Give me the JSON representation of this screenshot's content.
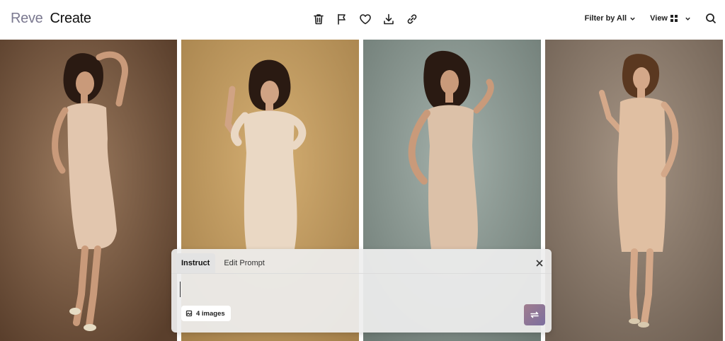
{
  "brand": {
    "name": "Reve",
    "section": "Create"
  },
  "toolbar": {
    "icons": [
      "trash-icon",
      "flag-icon",
      "heart-icon",
      "download-icon",
      "link-icon"
    ]
  },
  "controls": {
    "filter_label": "Filter by All",
    "view_label": "View"
  },
  "gallery": {
    "images": [
      {
        "background": "#7d5e45"
      },
      {
        "background": "#c39b62"
      },
      {
        "background": "#8e9c95"
      },
      {
        "background": "#8c7b6c"
      }
    ]
  },
  "panel": {
    "tabs": [
      {
        "label": "Instruct",
        "active": true
      },
      {
        "label": "Edit Prompt",
        "active": false
      }
    ],
    "input_value": "",
    "chip_label": "4 images"
  },
  "colors": {
    "brand_muted": "#7b7990",
    "accent_gradient_start": "#a07d8e",
    "accent_gradient_end": "#7c6f9f"
  }
}
